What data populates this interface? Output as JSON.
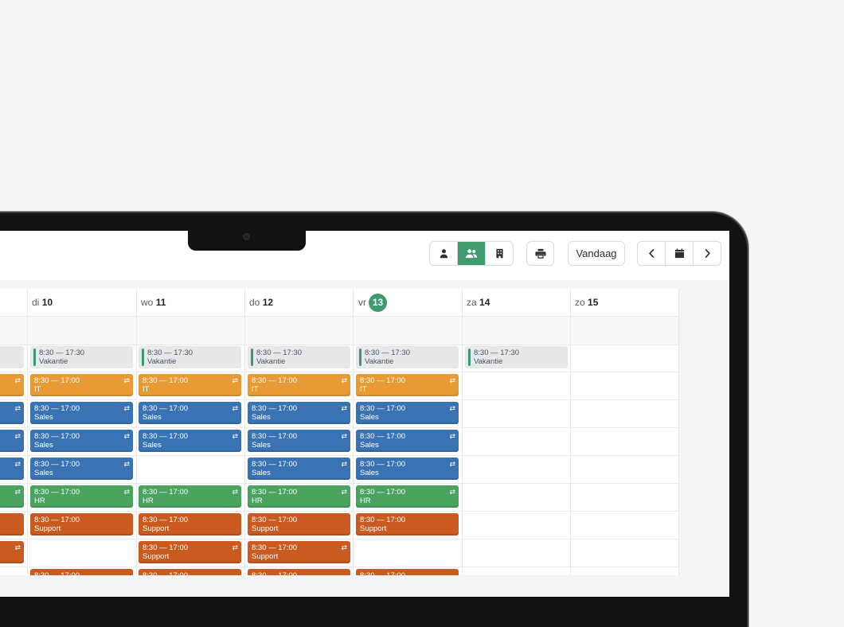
{
  "toolbar": {
    "today_label": "Vandaag"
  },
  "icons": {
    "view_single": "user-icon",
    "view_team": "users-icon",
    "view_building": "building-icon",
    "print": "printer-icon",
    "prev": "chevron-left-icon",
    "calendar": "calendar-icon",
    "next": "chevron-right-icon",
    "repeat": "repeat-icon"
  },
  "colors": {
    "accent": "#3f9a6e",
    "it": "#e89a34",
    "sales": "#3a73b3",
    "hr": "#4aa35f",
    "support": "#c95a20",
    "vacation": "#e7e8eb"
  },
  "days": [
    {
      "abbr": "di",
      "num": "10"
    },
    {
      "abbr": "wo",
      "num": "11"
    },
    {
      "abbr": "do",
      "num": "12"
    },
    {
      "abbr": "vr",
      "num": "13"
    },
    {
      "abbr": "za",
      "num": "14"
    },
    {
      "abbr": "zo",
      "num": "15"
    }
  ],
  "events": {
    "vacation_time": "8:30 — 17:30",
    "vacation_label": "Vakantie",
    "shift_time": "8:30 — 17:00",
    "it_label": "IT",
    "sales_label": "Sales",
    "hr_label": "HR",
    "support_label": "Support",
    "repeat_glyph": "⇄"
  }
}
